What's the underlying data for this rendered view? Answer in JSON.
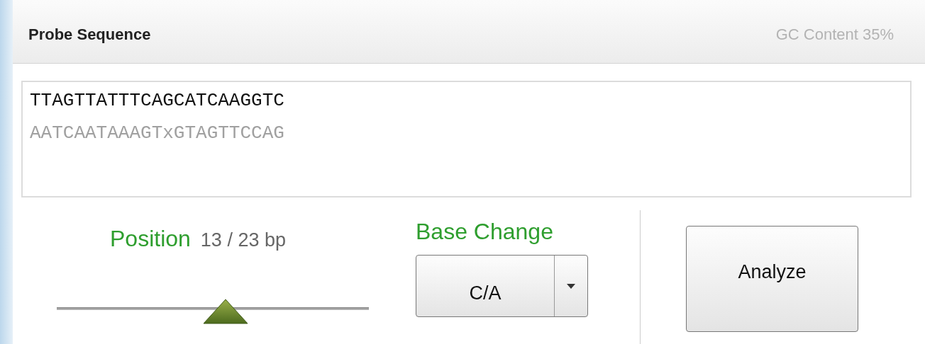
{
  "header": {
    "title": "Probe Sequence",
    "gc_content": "GC Content 35%"
  },
  "sequence": {
    "lines": [
      {
        "text": "TTAGTTATTTCAGCATCAAGGTC",
        "kind": "primary"
      },
      {
        "text": "AATCAATAAAGTxGTAGTTCCAG",
        "kind": "complement"
      }
    ]
  },
  "position": {
    "label": "Position",
    "reading": "13 / 23 bp",
    "level": 0.54
  },
  "base_change": {
    "label": "Base Change",
    "value": "C/A"
  },
  "analyze_button": "Analyze"
}
